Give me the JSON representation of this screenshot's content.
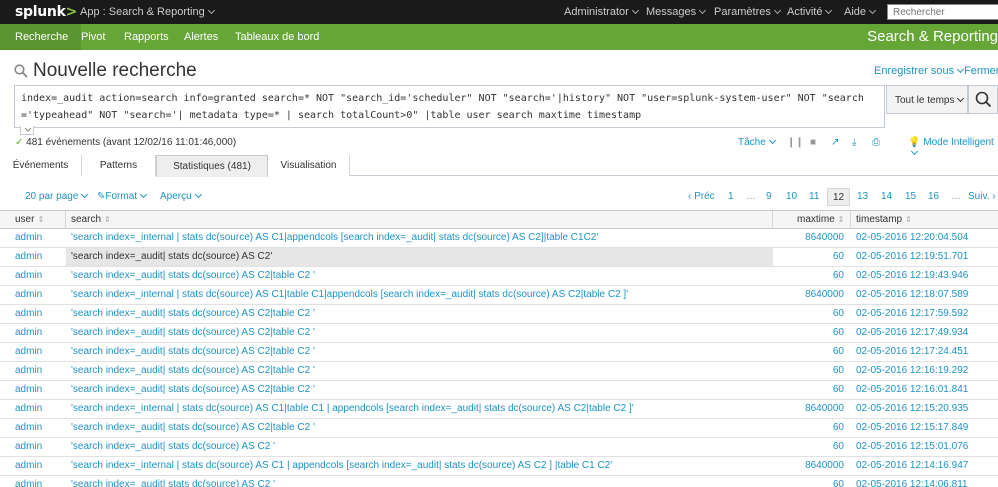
{
  "topbar": {
    "logo": "splunk",
    "logo_suffix": ">",
    "app": "App : Search & Reporting",
    "menus": [
      "Administrator",
      "Messages",
      "Paramètres",
      "Activité",
      "Aide"
    ],
    "search_placeholder": "Rechercher"
  },
  "nav": {
    "items": [
      "Recherche",
      "Pivot",
      "Rapports",
      "Alertes",
      "Tableaux de bord"
    ],
    "active": "Recherche",
    "app_title": "Search & Reporting"
  },
  "page": {
    "title": "Nouvelle recherche",
    "save_as": "Enregistrer sous",
    "close": "Fermer"
  },
  "search": {
    "query": "index=_audit action=search info=granted search=* NOT \"search_id='scheduler\" NOT \"search='|history\" NOT \"user=splunk-system-user\" NOT \"search='typeahead\" NOT \"search='| metadata type=* | search totalCount>0\" |table user search maxtime timestamp",
    "time_range": "Tout le temps"
  },
  "status": {
    "text": "481 événements (avant 12/02/16 11:01:46,000)",
    "job": "Tâche",
    "mode": "Mode Intelligent"
  },
  "tabs": [
    {
      "label": "Événements"
    },
    {
      "label": "Patterns"
    },
    {
      "label": "Statistiques (481)"
    },
    {
      "label": "Visualisation"
    }
  ],
  "active_tab": "Statistiques (481)",
  "pager": {
    "per_page": "20 par page",
    "format": "Format",
    "preview": "Aperçu",
    "prev": "‹ Préc",
    "next": "Suiv. ›",
    "pages": [
      "1",
      "…",
      "9",
      "10",
      "11",
      "12",
      "13",
      "14",
      "15",
      "16",
      "…"
    ],
    "current": "12"
  },
  "table": {
    "columns": [
      "user",
      "search",
      "maxtime",
      "timestamp"
    ],
    "rows": [
      {
        "user": "admin",
        "search": "'search index=_internal | stats dc(source) AS C1|appendcols [search index=_audit| stats dc(source) AS C2]|table C1C2'",
        "maxtime": "8640000",
        "timestamp": "02-05-2016 12:20:04.504"
      },
      {
        "user": "admin",
        "search": "'search index=_audit| stats dc(source) AS C2'",
        "maxtime": "60",
        "timestamp": "02-05-2016 12:19:51.701"
      },
      {
        "user": "admin",
        "search": "'search index=_audit| stats dc(source) AS C2|table C2 '",
        "maxtime": "60",
        "timestamp": "02-05-2016 12:19:43.946"
      },
      {
        "user": "admin",
        "search": "'search index=_internal | stats dc(source) AS C1|table C1|appendcols [search index=_audit| stats dc(source) AS C2|table C2 ]'",
        "maxtime": "8640000",
        "timestamp": "02-05-2016 12:18:07.589"
      },
      {
        "user": "admin",
        "search": "'search index=_audit| stats dc(source) AS C2|table C2 '",
        "maxtime": "60",
        "timestamp": "02-05-2016 12:17:59.592"
      },
      {
        "user": "admin",
        "search": "'search index=_audit| stats dc(source) AS C2|table C2 '",
        "maxtime": "60",
        "timestamp": "02-05-2016 12:17:49.934"
      },
      {
        "user": "admin",
        "search": "'search index=_audit| stats dc(source) AS C2|table C2 '",
        "maxtime": "60",
        "timestamp": "02-05-2016 12:17:24.451"
      },
      {
        "user": "admin",
        "search": "'search index=_audit| stats dc(source) AS C2|table C2 '",
        "maxtime": "60",
        "timestamp": "02-05-2016 12:16:19.292"
      },
      {
        "user": "admin",
        "search": "'search index=_audit| stats dc(source) AS C2|table C2 '",
        "maxtime": "60",
        "timestamp": "02-05-2016 12:16:01.841"
      },
      {
        "user": "admin",
        "search": "'search index=_internal | stats dc(source) AS C1|table C1 | appendcols [search index=_audit| stats dc(source) AS C2|table C2 ]'",
        "maxtime": "8640000",
        "timestamp": "02-05-2016 12:15:20.935"
      },
      {
        "user": "admin",
        "search": "'search index=_audit| stats dc(source) AS C2|table C2 '",
        "maxtime": "60",
        "timestamp": "02-05-2016 12:15:17.849"
      },
      {
        "user": "admin",
        "search": "'search index=_audit| stats dc(source) AS C2 '",
        "maxtime": "60",
        "timestamp": "02-05-2016 12:15:01.076"
      },
      {
        "user": "admin",
        "search": "'search index=_internal | stats dc(source) AS C1 | appendcols [search index=_audit| stats dc(source) AS C2 ] |table C1 C2'",
        "maxtime": "8640000",
        "timestamp": "02-05-2016 12:14:16.947"
      },
      {
        "user": "admin",
        "search": "'search index=_audit| stats dc(source) AS C2 '",
        "maxtime": "60",
        "timestamp": "02-05-2016 12:14:06.811"
      }
    ],
    "highlighted_row": 1
  },
  "colors": {
    "brand_green": "#65a637",
    "link_blue": "#1e93c6",
    "topbar": "#1a1a1a"
  }
}
